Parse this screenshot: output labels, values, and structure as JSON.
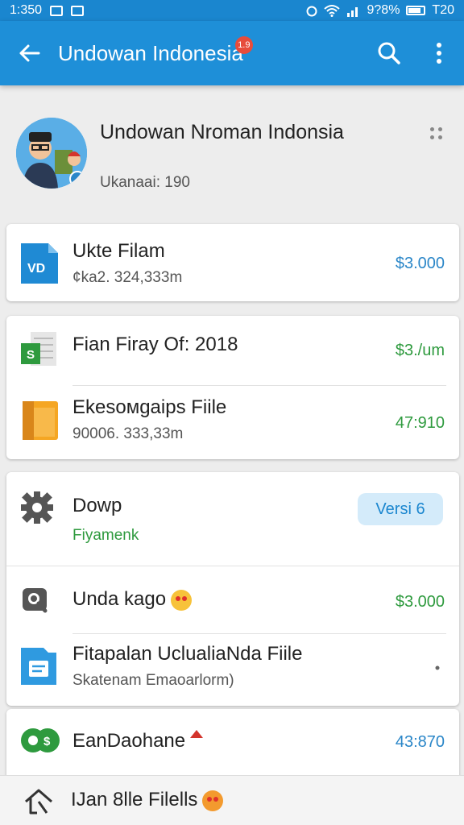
{
  "status_bar": {
    "time": "1:350",
    "battery_text": "9?8%",
    "right_text": "T20"
  },
  "app_bar": {
    "title": "Undowan Indonesia",
    "badge": "1.9"
  },
  "header": {
    "name": "Undowan Nroman Indonsia",
    "subtitle": "Ukanaai: 190"
  },
  "files": [
    {
      "title": "Ukte Filam",
      "subtitle": "¢ka2. 324,333m",
      "amount": "$3.000",
      "amount_color": "#2a86c8",
      "icon": "doc-blue-icon"
    },
    {
      "title": "Fian Firay Of: 2018",
      "subtitle": "",
      "amount": "$3./um",
      "amount_color": "#2e9a3e",
      "icon": "sheet-green-icon"
    },
    {
      "title": "Ekesoмgaips Fiile",
      "subtitle": "90006. 333,33m",
      "amount": "47:910",
      "amount_color": "#2e9a3e",
      "icon": "folder-orange-icon"
    },
    {
      "title": "Dowp",
      "subtitle": "Fiyamenk",
      "pill": "Versi 6",
      "icon": "gear-icon"
    },
    {
      "title": "Unda kago",
      "subtitle": "",
      "amount": "$3.000",
      "amount_color": "#2e9a3e",
      "icon": "search-box-icon"
    },
    {
      "title": "Fitapalan UclualiaNda Fiile",
      "subtitle": "Skatenam Emaoarlorm)",
      "amount": "",
      "icon": "doc-lightblue-icon"
    },
    {
      "title": "EanDaohane",
      "subtitle": "",
      "amount": "43:870",
      "amount_color": "#2a86c8",
      "icon": "green-dollar-icon"
    }
  ],
  "bottom_bar": {
    "title": "IJan 8lle Filells"
  },
  "colors": {
    "app_bar": "#1e8fd8",
    "status_bar": "#1a86cf",
    "background": "#ededed"
  }
}
